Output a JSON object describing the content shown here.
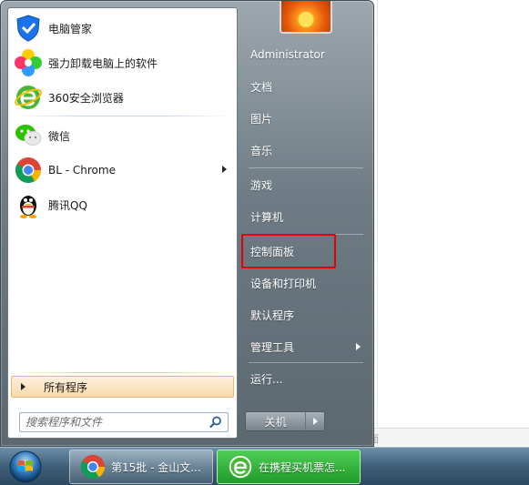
{
  "background_window": {
    "partial_text": "面"
  },
  "left_pane": {
    "items": [
      {
        "label": "电脑管家",
        "icon": "shield-icon",
        "has_submenu": false
      },
      {
        "label": "强力卸载电脑上的软件",
        "icon": "flower-icon",
        "has_submenu": false
      },
      {
        "label": "360安全浏览器",
        "icon": "browser-e-icon",
        "has_submenu": false
      },
      {
        "label": "微信",
        "icon": "wechat-icon",
        "has_submenu": false
      },
      {
        "label": "BL - Chrome",
        "icon": "chrome-icon",
        "has_submenu": true
      },
      {
        "label": "腾讯QQ",
        "icon": "qq-penguin-icon",
        "has_submenu": false
      }
    ],
    "all_programs": "所有程序",
    "search_placeholder": "搜索程序和文件"
  },
  "right_pane": {
    "items": [
      {
        "label": "Administrator",
        "has_submenu": false
      },
      {
        "label": "文档",
        "has_submenu": false
      },
      {
        "label": "图片",
        "has_submenu": false
      },
      {
        "label": "音乐",
        "has_submenu": false
      },
      {
        "label": "游戏",
        "has_submenu": false
      },
      {
        "label": "计算机",
        "has_submenu": false
      },
      {
        "label": "控制面板",
        "has_submenu": false,
        "highlighted": true
      },
      {
        "label": "设备和打印机",
        "has_submenu": false
      },
      {
        "label": "默认程序",
        "has_submenu": false
      },
      {
        "label": "管理工具",
        "has_submenu": true
      },
      {
        "label": "运行...",
        "has_submenu": false
      }
    ],
    "shutdown_label": "关机"
  },
  "taskbar": {
    "buttons": [
      {
        "label": "第15批 - 金山文...",
        "icon": "chrome-icon"
      },
      {
        "label": "在携程买机票怎...",
        "icon": "browser-e-icon",
        "active": true
      }
    ]
  },
  "colors": {
    "highlight_border": "#e30000",
    "all_programs_bg": "#f9d9a7",
    "taskbar_active": "#1f9b2a"
  }
}
